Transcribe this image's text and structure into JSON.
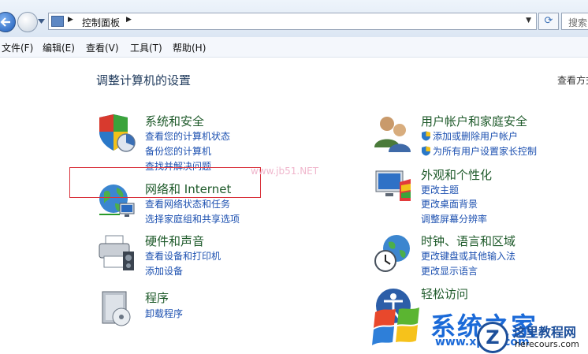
{
  "address_bar": {
    "breadcrumb": "控制面板",
    "search_text": "搜索"
  },
  "menu": [
    {
      "label": "文件(F)"
    },
    {
      "label": "编辑(E)"
    },
    {
      "label": "查看(V)"
    },
    {
      "label": "工具(T)"
    },
    {
      "label": "帮助(H)"
    }
  ],
  "page": {
    "title": "调整计算机的设置",
    "view_by": "查看方式"
  },
  "categories": {
    "system_security": {
      "title": "系统和安全",
      "links": [
        "查看您的计算机状态",
        "备份您的计算机",
        "查找并解决问题"
      ]
    },
    "network": {
      "title": "网络和 Internet",
      "links": [
        "查看网络状态和任务",
        "选择家庭组和共享选项"
      ]
    },
    "hardware": {
      "title": "硬件和声音",
      "links": [
        "查看设备和打印机",
        "添加设备"
      ]
    },
    "programs": {
      "title": "程序",
      "links": [
        "卸载程序"
      ]
    },
    "user_accounts": {
      "title": "用户帐户和家庭安全",
      "links": [
        "添加或删除用户帐户",
        "为所有用户设置家长控制"
      ]
    },
    "appearance": {
      "title": "外观和个性化",
      "links": [
        "更改主题",
        "更改桌面背景",
        "调整屏幕分辨率"
      ]
    },
    "clock": {
      "title": "时钟、语言和区域",
      "links": [
        "更改键盘或其他输入法",
        "更改显示语言"
      ]
    },
    "ease": {
      "title": "轻松访问"
    }
  },
  "watermarks": {
    "faint": "www.jb51.NET",
    "brand": "系统之家",
    "brand_url": "www.xp85.com",
    "site_name": "这里教程网",
    "site_url": "herecours.com"
  },
  "colors": {
    "category_title": "#1e5a2a",
    "link": "#1c50b0",
    "highlight_border": "#d9333c"
  }
}
